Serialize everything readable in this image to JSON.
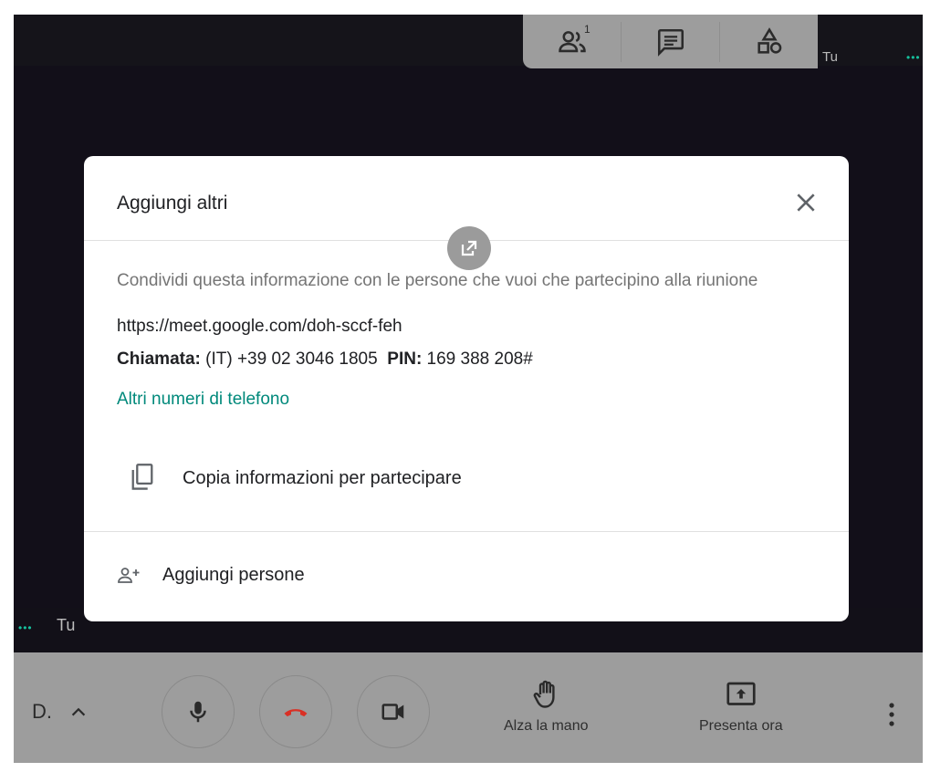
{
  "top_toolbar": {
    "participants_count": "1",
    "participants_icon": "people-icon",
    "chat_icon": "chat-icon",
    "activities_icon": "shapes-icon"
  },
  "self_tile": {
    "label_top": "Tu",
    "label_bottom": "Tu",
    "dots": "•••"
  },
  "dialog": {
    "title": "Aggiungi altri",
    "description": "Condividi questa informazione con le persone che vuoi che partecipino alla riunione",
    "meeting_url": "https://meet.google.com/doh-sccf-feh",
    "call_label": "Chiamata:",
    "call_number": "(IT) +39 02 3046 1805",
    "pin_label": "PIN:",
    "pin_value": "169 388 208#",
    "more_numbers_link": "Altri numeri di telefono",
    "copy_label": "Copia informazioni per partecipare",
    "add_people_label": "Aggiungi persone"
  },
  "bottom_bar": {
    "meeting_code": "D.",
    "raise_hand_label": "Alza la mano",
    "present_label": "Presenta ora"
  },
  "colors": {
    "accent_teal": "#00897b",
    "hangup_red": "#d93025",
    "dots_green": "#16c09d"
  }
}
